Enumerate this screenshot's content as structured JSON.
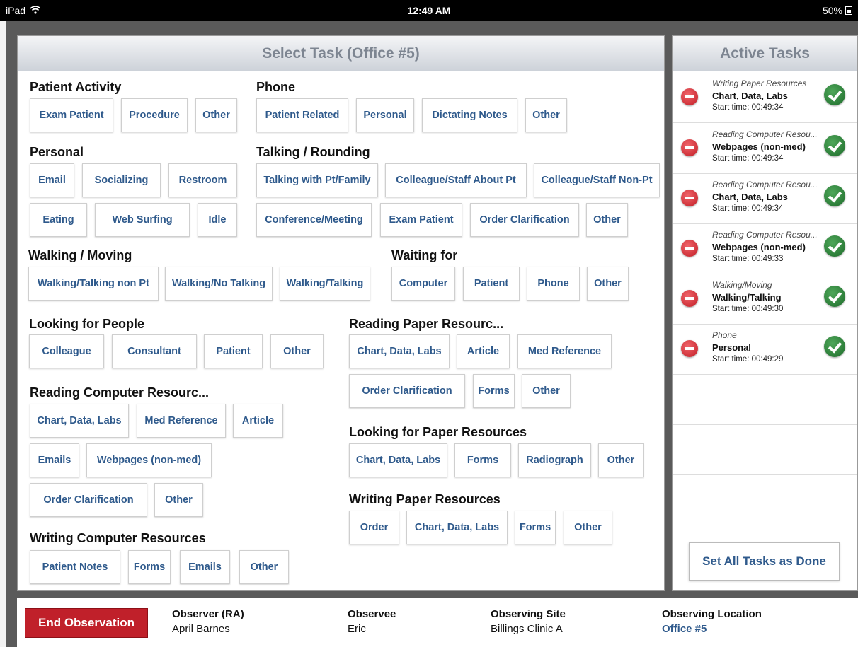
{
  "status_bar": {
    "device": "iPad",
    "time": "12:49 AM",
    "battery": "50%"
  },
  "select_task": {
    "header": "Select Task (Office #5)",
    "patient_activity": {
      "title": "Patient Activity",
      "buttons": [
        "Exam Patient",
        "Procedure",
        "Other"
      ]
    },
    "phone": {
      "title": "Phone",
      "buttons": [
        "Patient Related",
        "Personal",
        "Dictating Notes",
        "Other"
      ]
    },
    "personal": {
      "title": "Personal",
      "buttons": [
        "Email",
        "Socializing",
        "Restroom",
        "Eating",
        "Web Surfing",
        "Idle"
      ]
    },
    "talking_rounding": {
      "title": "Talking / Rounding",
      "buttons": [
        "Talking with Pt/Family",
        "Colleague/Staff About Pt",
        "Colleague/Staff Non-Pt",
        "Conference/Meeting",
        "Exam Patient",
        "Order Clarification",
        "Other"
      ]
    },
    "walking_moving": {
      "title": "Walking / Moving",
      "buttons": [
        "Walking/Talking non Pt",
        "Walking/No Talking",
        "Walking/Talking"
      ]
    },
    "waiting_for": {
      "title": "Waiting for",
      "buttons": [
        "Computer",
        "Patient",
        "Phone",
        "Other"
      ]
    },
    "looking_people": {
      "title": "Looking for People",
      "buttons": [
        "Colleague",
        "Consultant",
        "Patient",
        "Other"
      ]
    },
    "reading_paper": {
      "title": "Reading Paper Resourc...",
      "buttons": [
        "Chart, Data, Labs",
        "Article",
        "Med Reference",
        "Order Clarification",
        "Forms",
        "Other"
      ]
    },
    "reading_computer": {
      "title": "Reading Computer Resourc...",
      "buttons": [
        "Chart, Data, Labs",
        "Med Reference",
        "Article",
        "Emails",
        "Webpages (non-med)",
        "Order Clarification",
        "Other"
      ]
    },
    "looking_paper": {
      "title": "Looking for Paper Resources",
      "buttons": [
        "Chart, Data, Labs",
        "Forms",
        "Radiograph",
        "Other"
      ]
    },
    "writing_paper": {
      "title": "Writing Paper Resources",
      "buttons": [
        "Order",
        "Chart, Data, Labs",
        "Forms",
        "Other"
      ]
    },
    "writing_computer": {
      "title": "Writing Computer Resources",
      "buttons": [
        "Patient Notes",
        "Forms",
        "Emails",
        "Other"
      ]
    }
  },
  "active_tasks": {
    "header": "Active Tasks",
    "items": [
      {
        "category": "Writing Paper Resources",
        "name": "Chart, Data, Labs",
        "start": "Start time: 00:49:34"
      },
      {
        "category": "Reading Computer Resou...",
        "name": "Webpages (non-med)",
        "start": "Start time: 00:49:34"
      },
      {
        "category": "Reading Computer Resou...",
        "name": "Chart, Data, Labs",
        "start": "Start time: 00:49:34"
      },
      {
        "category": "Reading Computer Resou...",
        "name": "Webpages (non-med)",
        "start": "Start time: 00:49:33"
      },
      {
        "category": "Walking/Moving",
        "name": "Walking/Talking",
        "start": "Start time: 00:49:30"
      },
      {
        "category": "Phone",
        "name": "Personal",
        "start": "Start time: 00:49:29"
      }
    ],
    "set_all_done": "Set All Tasks as Done"
  },
  "footer": {
    "end_observation": "End Observation",
    "observer_label": "Observer (RA)",
    "observer": "April Barnes",
    "observee_label": "Observee",
    "observee": "Eric",
    "site_label": "Observing Site",
    "site": "Billings Clinic A",
    "location_label": "Observing Location",
    "location": "Office #5"
  },
  "colors": {
    "button_text": "#2f5a8c",
    "end_button": "#c0202a",
    "check": "#2e8b3a",
    "remove": "#d9272e"
  }
}
